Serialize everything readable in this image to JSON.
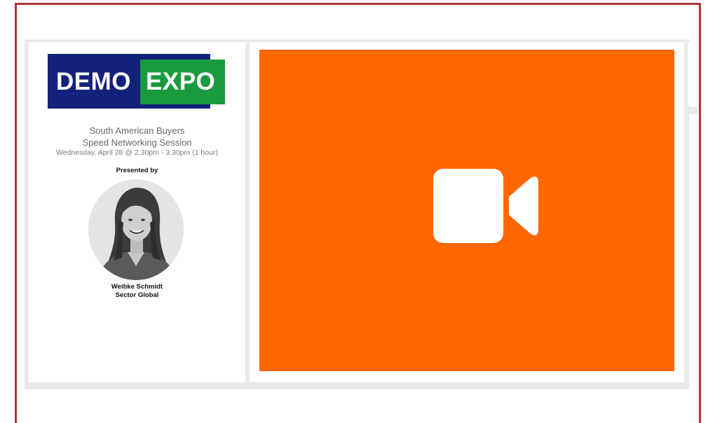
{
  "logo": {
    "left_word": "DEMO",
    "right_word": "EXPO",
    "colors": {
      "left_bg": "#13217a",
      "right_bg": "#1a9a3e"
    }
  },
  "session": {
    "title_line1": "South American Buyers",
    "title_line2": "Speed Networking Session",
    "date": "Wednesday, April 28 @ 2:30pm - 3:30pm (1 hour)"
  },
  "presenter": {
    "label": "Presented by",
    "name": "Weibke Schmidt",
    "company": "Sector Global"
  },
  "video": {
    "icon": "video-camera-icon",
    "background": "#ff6600"
  },
  "colors": {
    "frame_border": "#b0323a",
    "panel_bg": "#e9e9e9"
  }
}
